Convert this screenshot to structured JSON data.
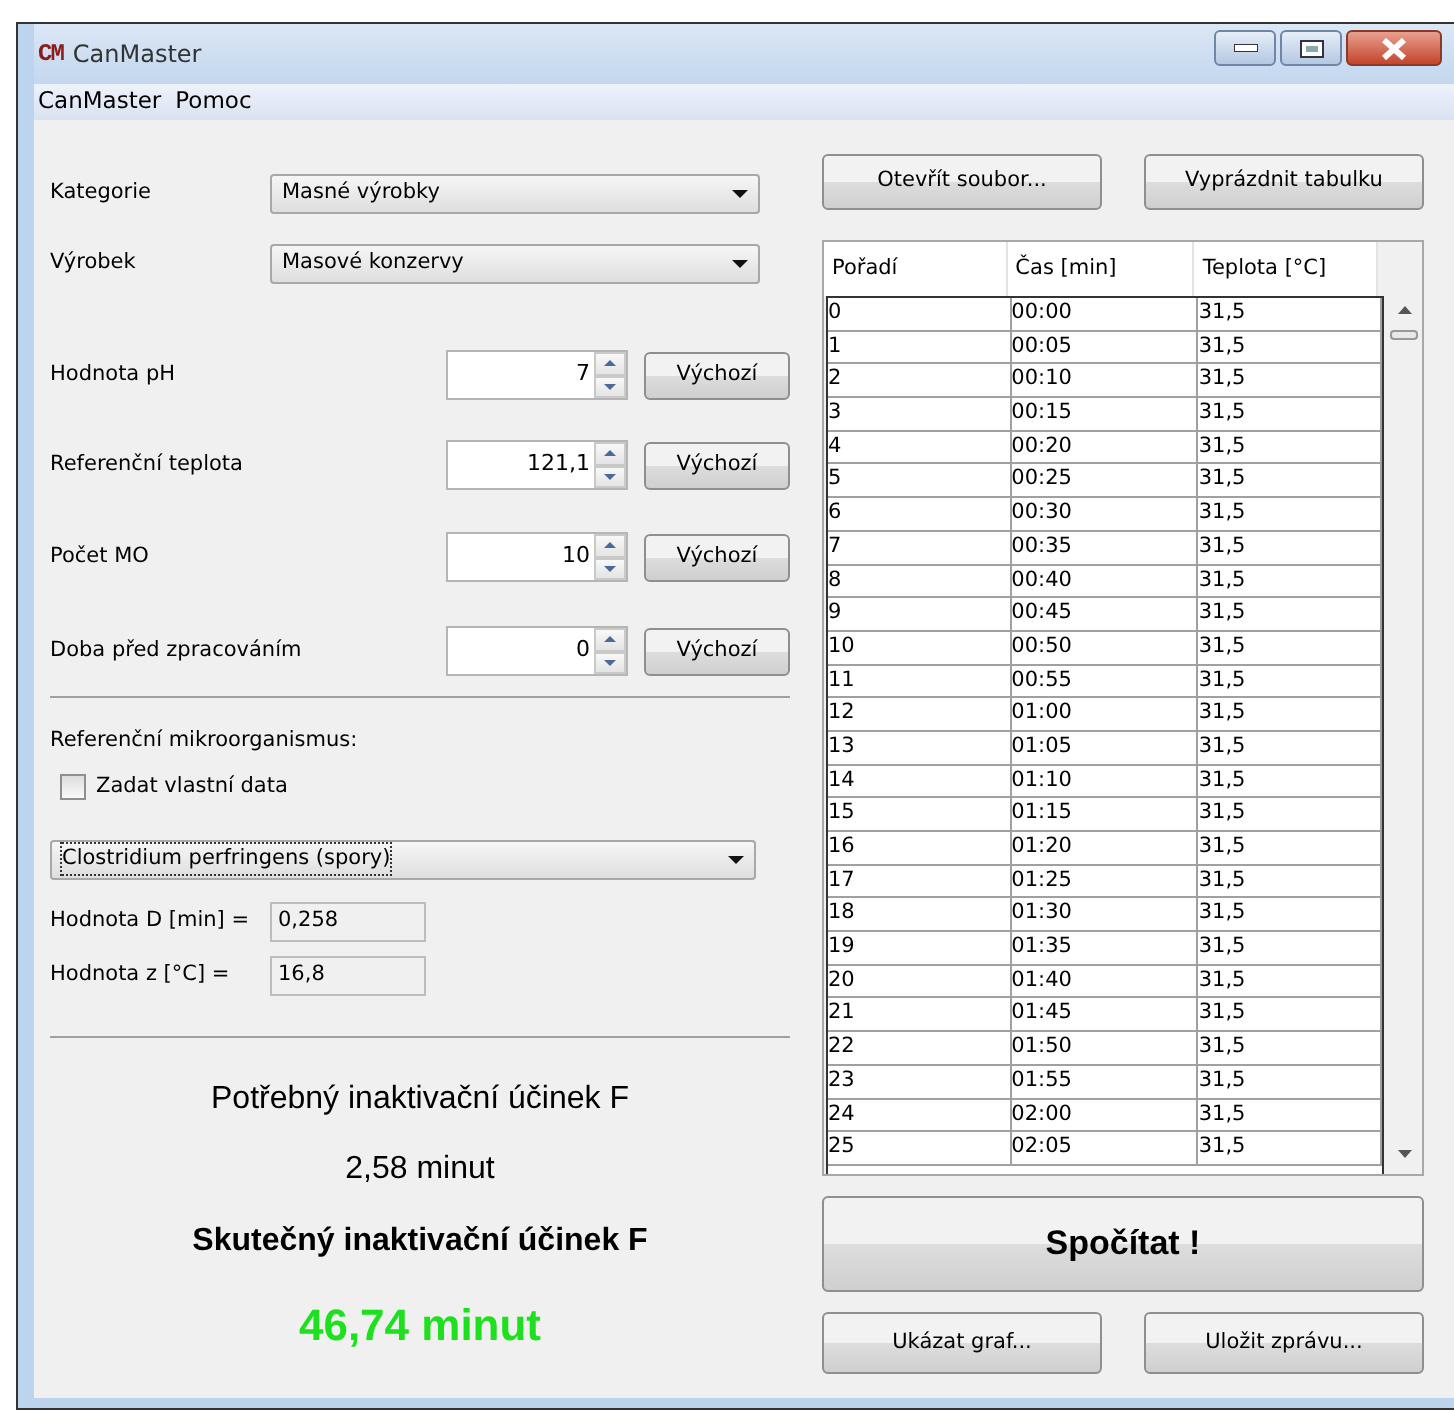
{
  "window": {
    "logo": "CM",
    "title": "CanMaster"
  },
  "menu": [
    "CanMaster",
    "Pomoc"
  ],
  "selects": [
    {
      "label": "Kategorie",
      "value": "Masné výrobky"
    },
    {
      "label": "Výrobek",
      "value": "Masové konzervy"
    }
  ],
  "spin_fields": [
    {
      "label": "Hodnota pH",
      "value": "7",
      "button": "Výchozí"
    },
    {
      "label": "Referenční teplota",
      "value": "121,1",
      "button": "Výchozí"
    },
    {
      "label": "Počet MO",
      "value": "10",
      "button": "Výchozí"
    },
    {
      "label": "Doba před zpracováním",
      "value": "0",
      "button": "Výchozí"
    }
  ],
  "microorganism": {
    "heading": "Referenční mikroorganismus:",
    "custom_data": {
      "label": "Zadat vlastní data",
      "checked": false
    },
    "select": "Clostridium perfringens (spory)",
    "values": [
      {
        "label": "Hodnota D [min] =",
        "value": "0,258"
      },
      {
        "label": "Hodnota z [°C] =",
        "value": "16,8"
      }
    ]
  },
  "results": {
    "required_label": "Potřebný inaktivační účinek F",
    "required_value": "2,58 minut",
    "actual_label": "Skutečný inaktivační účinek F",
    "actual_value": "46,74 minut"
  },
  "file_buttons": [
    "Otevřít soubor...",
    "Vyprázdnit tabulku"
  ],
  "table": {
    "columns": [
      "Pořadí",
      "Čas [min]",
      "Teplota [°C]"
    ],
    "rows": [
      [
        "0",
        "00:00",
        "31,5"
      ],
      [
        "1",
        "00:05",
        "31,5"
      ],
      [
        "2",
        "00:10",
        "31,5"
      ],
      [
        "3",
        "00:15",
        "31,5"
      ],
      [
        "4",
        "00:20",
        "31,5"
      ],
      [
        "5",
        "00:25",
        "31,5"
      ],
      [
        "6",
        "00:30",
        "31,5"
      ],
      [
        "7",
        "00:35",
        "31,5"
      ],
      [
        "8",
        "00:40",
        "31,5"
      ],
      [
        "9",
        "00:45",
        "31,5"
      ],
      [
        "10",
        "00:50",
        "31,5"
      ],
      [
        "11",
        "00:55",
        "31,5"
      ],
      [
        "12",
        "01:00",
        "31,5"
      ],
      [
        "13",
        "01:05",
        "31,5"
      ],
      [
        "14",
        "01:10",
        "31,5"
      ],
      [
        "15",
        "01:15",
        "31,5"
      ],
      [
        "16",
        "01:20",
        "31,5"
      ],
      [
        "17",
        "01:25",
        "31,5"
      ],
      [
        "18",
        "01:30",
        "31,5"
      ],
      [
        "19",
        "01:35",
        "31,5"
      ],
      [
        "20",
        "01:40",
        "31,5"
      ],
      [
        "21",
        "01:45",
        "31,5"
      ],
      [
        "22",
        "01:50",
        "31,5"
      ],
      [
        "23",
        "01:55",
        "31,5"
      ],
      [
        "24",
        "02:00",
        "31,5"
      ],
      [
        "25",
        "02:05",
        "31,5"
      ]
    ]
  },
  "calculate_button": "Spočítat !",
  "bottom_buttons": [
    "Ukázat graf...",
    "Uložit zprávu..."
  ]
}
